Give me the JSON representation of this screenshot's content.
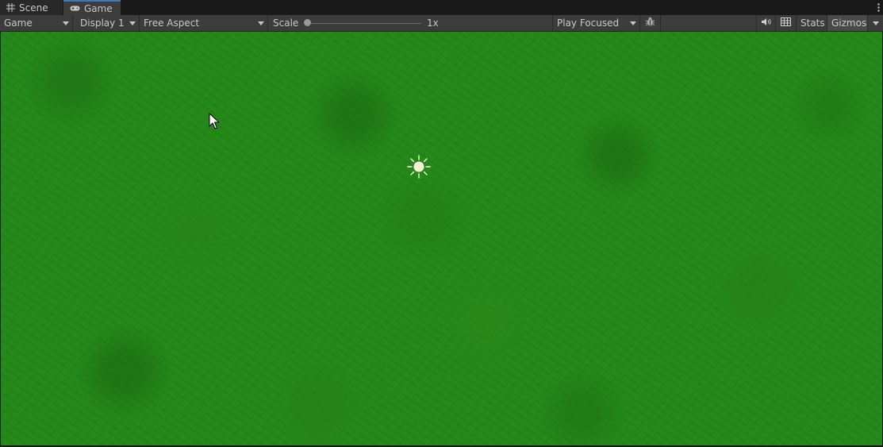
{
  "tabs": [
    {
      "label": "Scene",
      "icon": "grid-icon",
      "active": false
    },
    {
      "label": "Game",
      "icon": "gamepad-icon",
      "active": true
    }
  ],
  "toolbar": {
    "view_mode": "Game",
    "display": "Display 1",
    "aspect": "Free Aspect",
    "scale_label": "Scale",
    "scale_value": "1x",
    "play_mode": "Play Focused",
    "stats_label": "Stats",
    "gizmos_label": "Gizmos"
  },
  "icons": {
    "bug": "bug-icon",
    "audio": "speaker-icon",
    "grid": "grid-toggle-icon",
    "more": "more-options-icon",
    "light": "directional-light-gizmo-icon",
    "cursor": "mouse-cursor-icon"
  },
  "colors": {
    "grass": "#24881a",
    "active_tab_accent": "#3a79bb",
    "toolbar_bg": "#3c3c3c"
  }
}
